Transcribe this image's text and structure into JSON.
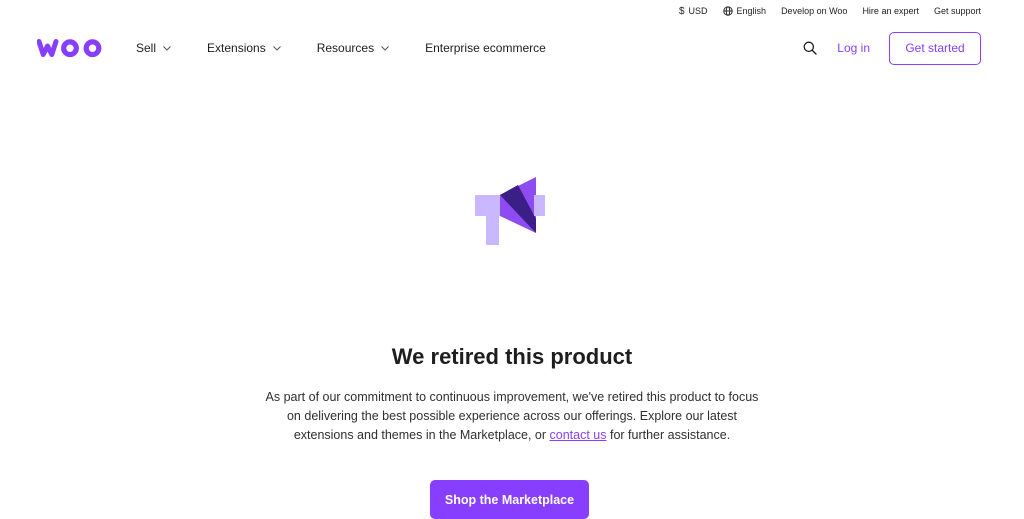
{
  "utility": {
    "currency": "USD",
    "language": "English",
    "develop": "Develop on Woo",
    "hire": "Hire an expert",
    "support": "Get support"
  },
  "nav": {
    "logo_text": "woo",
    "items": [
      {
        "label": "Sell",
        "has_dropdown": true
      },
      {
        "label": "Extensions",
        "has_dropdown": true
      },
      {
        "label": "Resources",
        "has_dropdown": true
      },
      {
        "label": "Enterprise ecommerce",
        "has_dropdown": false
      }
    ],
    "login": "Log in",
    "get_started": "Get started"
  },
  "hero": {
    "title": "We retired this product",
    "body_before": "As part of our commitment to continuous improvement, we've retired this product to focus on delivering the best possible experience across our offerings. Explore our latest extensions and themes in the Marketplace, or ",
    "link": "contact us",
    "body_after": " for further assistance.",
    "cta": "Shop the Marketplace"
  },
  "colors": {
    "brand": "#873eff",
    "megaphone_light": "#c9b7ff",
    "megaphone_mid": "#8f4bf2",
    "megaphone_dark": "#3c1e87"
  },
  "icons": [
    "dollar-icon",
    "globe-icon",
    "chevron-down-icon",
    "search-icon",
    "megaphone-icon",
    "woo-logo"
  ]
}
